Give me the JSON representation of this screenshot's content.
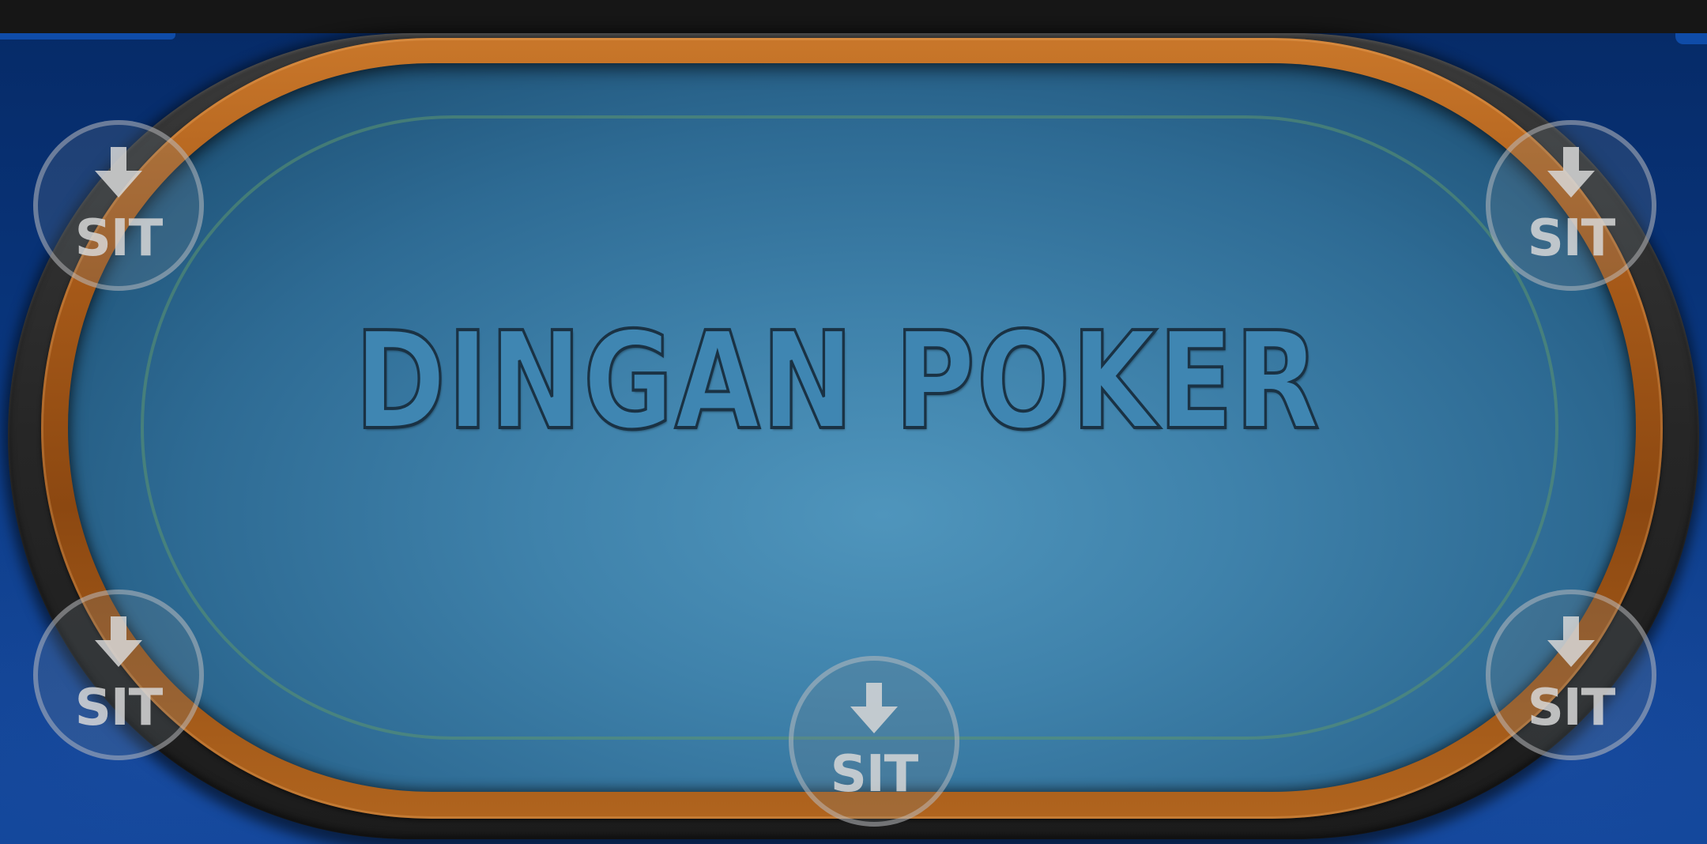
{
  "table": {
    "title": "DINGAN POKER"
  },
  "seats": [
    {
      "label": "SIT",
      "icon": "down-arrow-icon"
    },
    {
      "label": "SIT",
      "icon": "down-arrow-icon"
    },
    {
      "label": "SIT",
      "icon": "down-arrow-icon"
    },
    {
      "label": "SIT",
      "icon": "down-arrow-icon"
    },
    {
      "label": "SIT",
      "icon": "down-arrow-icon"
    }
  ],
  "colors": {
    "felt": "#3f82ab",
    "wood": "#a75a19",
    "rail": "#262626",
    "background": "#0a3a86",
    "top_bar": "#161616"
  }
}
